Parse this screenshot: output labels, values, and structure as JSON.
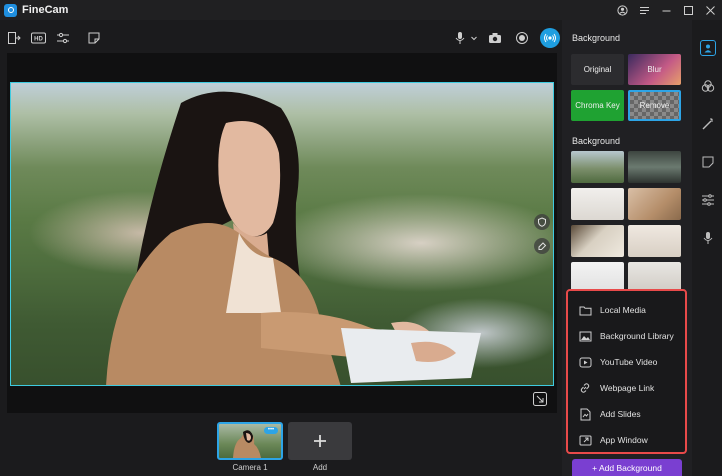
{
  "app": {
    "title": "FineCam"
  },
  "panel": {
    "background_heading": "Background",
    "modes": [
      {
        "label": "Original",
        "selected": false
      },
      {
        "label": "Blur",
        "selected": false
      },
      {
        "label": "Chroma Key",
        "selected": false
      },
      {
        "label": "Remove",
        "selected": true
      }
    ],
    "library_heading": "Background"
  },
  "menu": {
    "items": [
      {
        "label": "Local Media",
        "icon": "folder-icon"
      },
      {
        "label": "Background Library",
        "icon": "image-icon"
      },
      {
        "label": "YouTube Video",
        "icon": "play-icon"
      },
      {
        "label": "Webpage Link",
        "icon": "link-icon"
      },
      {
        "label": "Add Slides",
        "icon": "slides-icon"
      },
      {
        "label": "App Window",
        "icon": "window-icon"
      }
    ]
  },
  "add_background_label": "+ Add Background",
  "thumbnails": [
    {
      "label": "Camera 1"
    },
    {
      "label": "Add"
    }
  ],
  "colors": {
    "accent": "#2da4e6",
    "highlight_border": "#e84a4a",
    "add_button": "#7a3fd1",
    "chroma_key": "#1fa232"
  }
}
